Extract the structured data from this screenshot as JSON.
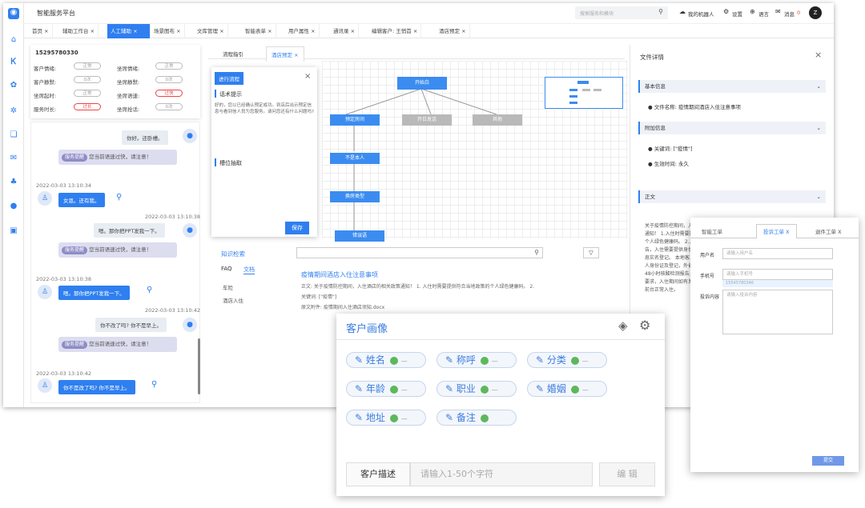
{
  "app": {
    "title": "智能服务平台",
    "search_placeholder": "搜索服务和模块",
    "robot": "我的机器人",
    "settings": "设置",
    "language": "语言",
    "messages": "消息",
    "msg_count": "0",
    "user_initial": "Z"
  },
  "tabs": [
    "首页",
    "辅助工作台",
    "人工辅助",
    "场景图布",
    "文库管理",
    "智能表单",
    "用户属性",
    "通讯录",
    "编辑客户: 王悄首",
    "酒店预定"
  ],
  "customer": {
    "phone": "15295780330",
    "fields": [
      {
        "label": "客户情绪:",
        "value": "正常"
      },
      {
        "label": "坐席情绪:",
        "value": "正常"
      },
      {
        "label": "客户静默:",
        "value": "0次"
      },
      {
        "label": "坐席静默:",
        "value": "0次"
      },
      {
        "label": "坐席起时:",
        "value": "正常"
      },
      {
        "label": "坐席语速:",
        "value": "过快"
      },
      {
        "label": "服务时长:",
        "value": "过长"
      },
      {
        "label": "坐席抢话:",
        "value": "0次"
      }
    ]
  },
  "chat": {
    "msg1": "你好。还卧槽。",
    "sys_badge": "服务提醒",
    "sys_text": "您当前语速过快，请注意！",
    "ts1": "2022-03-03 13:10:34",
    "msg2": "女恩。还有我。",
    "ts2": "2022-03-03 13:10:38",
    "msg3": "嗯。那你把PPT发我一下。",
    "ts3": "2022-03-03 13:10:38",
    "msg4": "嗯。那你把PPT发我一下。",
    "ts4": "2022-03-03 13:10:42",
    "msg5": "你不改了吗? 你不是早上。",
    "ts5": "2022-03-03 13:10:42",
    "msg6": "你不是改了吗? 你不是早上。"
  },
  "flow": {
    "subtabs": [
      "流程指引",
      "酒店预定"
    ],
    "panel_tab": "进行流程",
    "hint_title": "话术提示",
    "hint_text": "好的，您以已经确认预定成功。到店后出示预定信息与看到信人员为您服务。请问您还有什么问题吗?",
    "extract": "槽位抽取",
    "save": "保存",
    "nodes": {
      "start": "开始白",
      "n1": "预定房间",
      "n2": "开日发话",
      "n3": "其他",
      "n4": "不是本人",
      "n5": "换房类型",
      "n6": "错误语"
    }
  },
  "knowledge": {
    "title": "知识检索",
    "tab_faq": "FAQ",
    "tab_doc": "文档",
    "cats": [
      "车险",
      "酒店入住"
    ],
    "result_title": "疫情期间酒店入住注意事项",
    "result_body": "正文: 关于疫情防控期间，入住酒店的相关政策通知！ 1. 入住时需要提供符合当地政策的个人绿色健康码。 2.",
    "result_kw": "关键词: [\"疫情\"]",
    "result_attach": "原文附件: 疫情期间入住酒店须知.docx"
  },
  "doc": {
    "title": "文件详情",
    "basic": "基本信息",
    "docname": "文件名称: 疫情期间酒店入住注意事项",
    "extra": "附加信息",
    "kw": "关键词: [\"疫情\"]",
    "eff": "生效时间: 永久",
    "body_h": "正文",
    "body": "关于疫情防控期间，入住酒店的相关政策通知！ 1.入住时需要提供符合当地政策的个人绿色健康码。 2.入住时需提供测试报告，入住需要提供身份证，同住人员需信息实名登记。 本地客人入住本店需提供本人身份证及登记，外省客人入住上需提供48小时核酸检测报告，入住需按本店防疫要求，入住期间如有发热症状请及时告知前台正常入住。"
  },
  "portrait": {
    "title": "客户画像",
    "chips": [
      "姓名",
      "称呼",
      "分类",
      "年龄",
      "职业",
      "婚姻",
      "地址",
      "备注"
    ],
    "dash": "—",
    "desc_label": "客户描述",
    "desc_placeholder": "请输入1-50个字符",
    "edit": "编 辑"
  },
  "workorder": {
    "tabs": [
      "智能工单",
      "投诉工单 X",
      "退件工单 X"
    ],
    "user_label": "用户名",
    "user_ph": "请输入用户名",
    "phone_label": "手机号",
    "phone_ph": "请输入手机号",
    "phone_val": "15545780346",
    "content_label": "投诉内容",
    "content_ph": "请输入投诉内容",
    "submit": "提交"
  }
}
